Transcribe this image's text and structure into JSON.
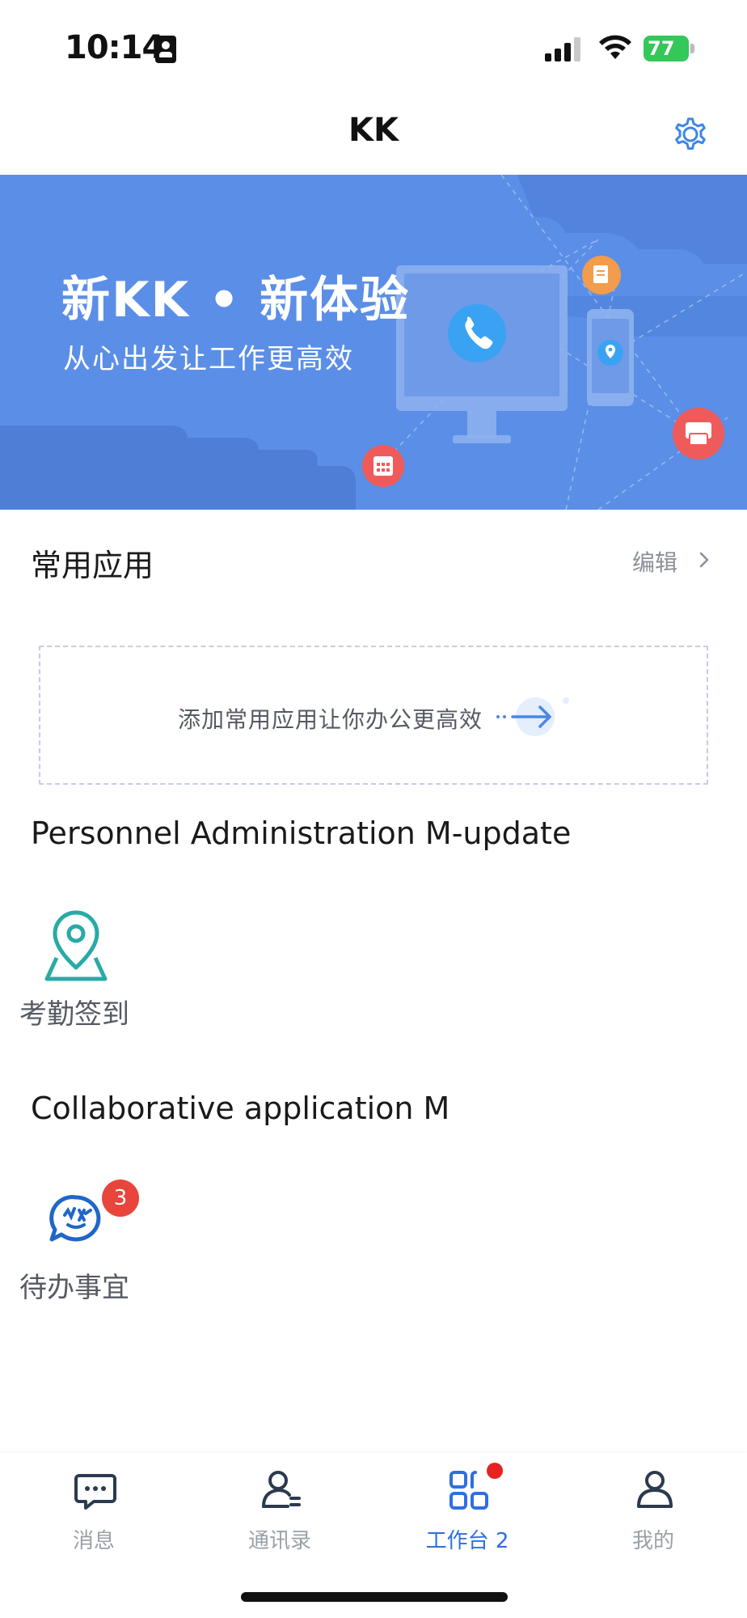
{
  "status_bar": {
    "time": "10:14",
    "battery": "77"
  },
  "nav": {
    "title": "KK"
  },
  "banner": {
    "title": "新KK • 新体验",
    "subtitle": "从心出发让工作更高效"
  },
  "common_apps": {
    "title": "常用应用",
    "edit_label": "编辑",
    "add_prompt": "添加常用应用让你办公更高效"
  },
  "groups": [
    {
      "title": "Personnel Administration M-update",
      "apps": [
        {
          "label": "考勤签到",
          "icon": "location-pin-icon",
          "color": "#29aaa7"
        }
      ]
    },
    {
      "title": "Collaborative application M",
      "apps": [
        {
          "label": "待办事宜",
          "icon": "chat-todo-icon",
          "color": "#1f67c7",
          "badge": "3"
        }
      ]
    }
  ],
  "tabs": [
    {
      "label": "消息",
      "icon": "message-icon",
      "active": false
    },
    {
      "label": "通讯录",
      "icon": "contacts-icon",
      "active": false
    },
    {
      "label": "工作台 2",
      "icon": "workbench-icon",
      "active": true
    },
    {
      "label": "我的",
      "icon": "profile-icon",
      "active": false
    }
  ],
  "colors": {
    "accent": "#2f6fe0",
    "banner_bg": "#5b8ee6",
    "badge": "#e8453c",
    "inactive_tab": "#9aa0a8"
  }
}
